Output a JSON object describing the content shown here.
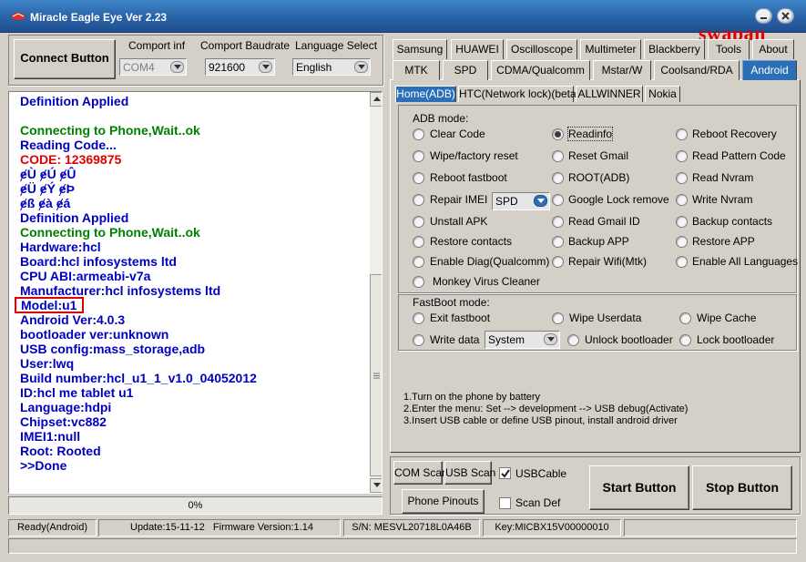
{
  "window": {
    "title": "Miracle Eagle Eye  Ver 2.23",
    "brand_text": "swapan"
  },
  "connection": {
    "connect_button": "Connect Button",
    "com_port_label": "Comport inf",
    "com_port_value": "COM4",
    "baudrate_label": "Comport Baudrate",
    "baudrate_value": "921600",
    "language_label": "Language Select",
    "language_value": "English"
  },
  "log": {
    "lines": [
      {
        "text": "Definition Applied",
        "color": "#0000c0"
      },
      {
        "text": "",
        "color": "#0000c0"
      },
      {
        "text": "Connecting to Phone,Wait..ok",
        "color": "#008000"
      },
      {
        "text": "Reading Code...",
        "color": "#0000c0"
      },
      {
        "text": "CODE: 12369875",
        "color": "#e00000"
      },
      {
        "text": "ɇÙ ɇÚ ɇÛ",
        "color": "#0000c0"
      },
      {
        "text": "ɇÜ ɇÝ ɇÞ",
        "color": "#0000c0"
      },
      {
        "text": "ɇß ɇà ɇá",
        "color": "#0000c0"
      },
      {
        "text": "Definition Applied",
        "color": "#0000c0"
      },
      {
        "text": "Connecting to Phone,Wait..ok",
        "color": "#008000"
      },
      {
        "text": "Hardware:hcl",
        "color": "#0000c0"
      },
      {
        "text": "Board:hcl infosystems ltd",
        "color": "#0000c0"
      },
      {
        "text": "CPU ABI:armeabi-v7a",
        "color": "#0000c0"
      },
      {
        "text": "Manufacturer:hcl infosystems ltd",
        "color": "#0000c0"
      },
      {
        "text": "Model:u1",
        "color": "#0000c0",
        "highlight": true
      },
      {
        "text": "Android Ver:4.0.3",
        "color": "#0000c0"
      },
      {
        "text": "bootloader ver:unknown",
        "color": "#0000c0"
      },
      {
        "text": "USB config:mass_storage,adb",
        "color": "#0000c0"
      },
      {
        "text": "User:lwq",
        "color": "#0000c0"
      },
      {
        "text": "Build number:hcl_u1_1_v1.0_04052012",
        "color": "#0000c0"
      },
      {
        "text": "ID:hcl me tablet u1",
        "color": "#0000c0"
      },
      {
        "text": "Language:hdpi",
        "color": "#0000c0"
      },
      {
        "text": "Chipset:vc882",
        "color": "#0000c0"
      },
      {
        "text": "IMEI1:null",
        "color": "#0000c0"
      },
      {
        "text": "Root:  Rooted",
        "color": "#0000c0"
      },
      {
        "text": ">>Done",
        "color": "#0000c0"
      }
    ],
    "highlight_color": "#e00000"
  },
  "progress": {
    "text": "0%",
    "value": 0
  },
  "tabs_row1": [
    "Samsung",
    "HUAWEI",
    "Oscilloscope",
    "Multimeter",
    "Blackberry",
    "Tools",
    "About"
  ],
  "tabs_row2": [
    "MTK",
    "SPD",
    "CDMA/Qualcomm",
    "Mstar/W",
    "Coolsand/RDA",
    "Android"
  ],
  "active_tab": "Android",
  "subtabs": [
    "Home(ADB)",
    "HTC(Network lock)(beta)",
    "ALLWINNER",
    "Nokia"
  ],
  "active_subtab": "Home(ADB)",
  "adb": {
    "title": "ADB mode:",
    "col1": [
      "Clear Code",
      "Wipe/factory reset",
      "Reboot fastboot",
      "Repair IMEI",
      "Unstall APK",
      "Restore contacts",
      "Enable Diag(Qualcomm)",
      "Monkey Virus Cleaner"
    ],
    "col2": [
      "Readinfo",
      "Reset Gmail",
      "ROOT(ADB)",
      "Google Lock remove",
      "Read Gmail ID",
      "Backup APP",
      "Repair Wifi(Mtk)"
    ],
    "col3": [
      "Reboot Recovery",
      "Read Pattern Code",
      "Read Nvram",
      "Write Nvram",
      "Backup contacts",
      "Restore APP",
      "Enable All Languages"
    ],
    "selected": "Readinfo",
    "imei_combo": "SPD"
  },
  "fastboot": {
    "title": "FastBoot mode:",
    "row1": [
      "Exit fastboot",
      "Wipe Userdata",
      "Wipe Cache"
    ],
    "write_data": "Write data",
    "write_combo": "System",
    "row2_rest": [
      "Unlock bootloader",
      "Lock bootloader"
    ]
  },
  "instructions": [
    "1.Turn on the phone by battery",
    "2.Enter the menu: Set --> development --> USB debug(Activate)",
    "3.Insert USB cable or define USB pinout, install android driver"
  ],
  "bottom": {
    "com_scan": "COM Scan",
    "usb_scan": "USB Scan",
    "usb_cable": "USBCable",
    "usb_cable_checked": true,
    "phone_pinouts": "Phone Pinouts",
    "scan_def": "Scan Def",
    "scan_def_checked": false,
    "start": "Start Button",
    "stop": "Stop Button"
  },
  "status": {
    "state": "Ready(Android)",
    "update": "Update:15-11-12",
    "firmware": "Firmware Version:1.14",
    "sn": "S/N: MESVL20718L0A46B",
    "key": "Key:MICBX15V00000010"
  }
}
